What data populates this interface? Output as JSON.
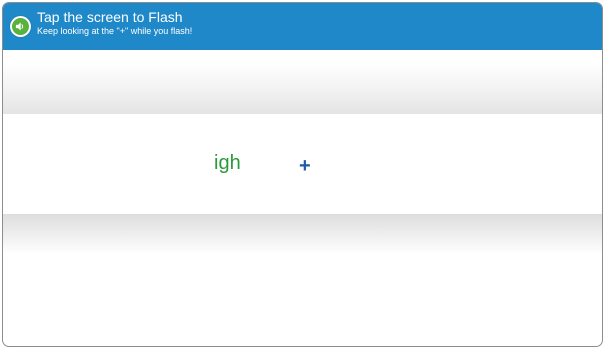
{
  "header": {
    "title": "Tap the screen to Flash",
    "subtitle": "Keep looking at the \"+\" while you flash!",
    "background_color": "#1e88c9",
    "audio_icon": "speaker-icon",
    "audio_icon_color": "#58b23d"
  },
  "flash_strip": {
    "word": "igh",
    "word_color": "#2a9a3a",
    "fixation_mark": "+",
    "fixation_color": "#1f5aa6"
  }
}
